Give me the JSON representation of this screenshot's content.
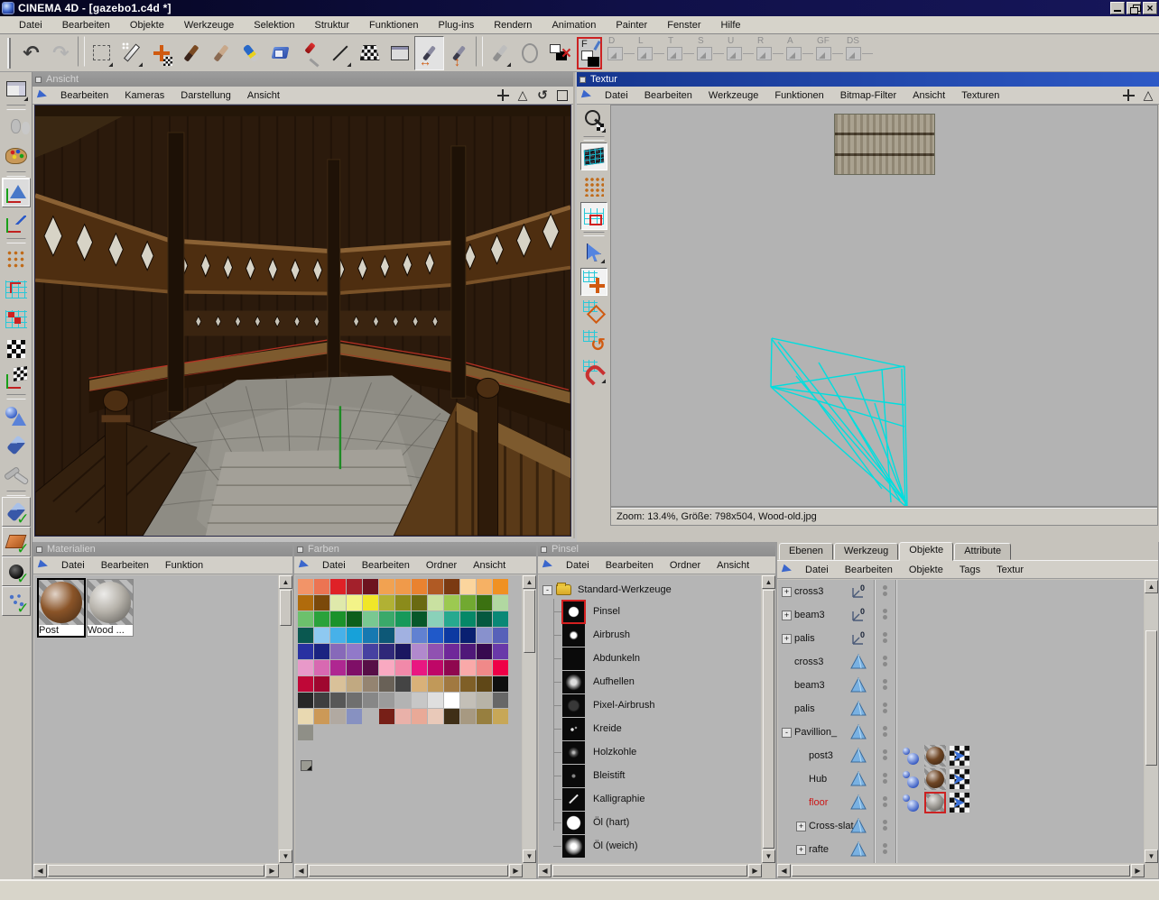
{
  "window": {
    "title": "CINEMA 4D - [gazebo1.c4d *]",
    "control_icons": [
      "minimize-icon",
      "restore-icon",
      "close-icon"
    ]
  },
  "menubar": [
    {
      "label": "Datei"
    },
    {
      "label": "Bearbeiten"
    },
    {
      "label": "Objekte"
    },
    {
      "label": "Werkzeuge"
    },
    {
      "label": "Selektion"
    },
    {
      "label": "Struktur"
    },
    {
      "label": "Funktionen"
    },
    {
      "label": "Plug-ins"
    },
    {
      "label": "Rendern"
    },
    {
      "label": "Animation"
    },
    {
      "label": "Painter"
    },
    {
      "label": "Fenster"
    },
    {
      "label": "Hilfe"
    }
  ],
  "toolbar": {
    "icons": [
      {
        "name": "undo-icon",
        "cls": "i-undo"
      },
      {
        "name": "redo-icon",
        "cls": "i-redo"
      },
      {
        "name": "separator",
        "cls": "i-sep"
      },
      {
        "name": "marquee-select-icon",
        "cls": "i-marquee"
      },
      {
        "name": "magic-wand-icon",
        "cls": "i-wand"
      },
      {
        "name": "move-texture-icon",
        "cls": "i-movetex"
      },
      {
        "name": "paint-brush-icon",
        "cls": "i-brush"
      },
      {
        "name": "smudge-tool-icon",
        "cls": "i-smudge"
      },
      {
        "name": "crayon-icon",
        "cls": "i-crayon"
      },
      {
        "name": "fill-bucket-icon",
        "cls": "i-bucket"
      },
      {
        "name": "screwdriver-tool-icon",
        "cls": "i-screw"
      },
      {
        "name": "line-tool-icon",
        "cls": "i-line"
      },
      {
        "name": "uv-mapping-icon",
        "cls": "i-uvtrap"
      },
      {
        "name": "render-settings-icon",
        "cls": "i-dialog"
      },
      {
        "name": "apply-brush-horizontal-icon",
        "cls": "i-arrh",
        "state": "pressed"
      },
      {
        "name": "apply-brush-vertical-icon",
        "cls": "i-arrv"
      },
      {
        "name": "separator",
        "cls": "i-sep"
      },
      {
        "name": "brush-preset-icon",
        "cls": "i-graybrush"
      },
      {
        "name": "oval-tool-icon",
        "cls": "i-oval"
      },
      {
        "name": "clear-layer-icon",
        "cls": "i-multix"
      }
    ],
    "active_channel": "F",
    "channels": [
      {
        "label": "D",
        "name": "channel-d-button"
      },
      {
        "label": "L",
        "name": "channel-l-button"
      },
      {
        "label": "T",
        "name": "channel-t-button"
      },
      {
        "label": "S",
        "name": "channel-s-button"
      },
      {
        "label": "U",
        "name": "channel-u-button"
      },
      {
        "label": "R",
        "name": "channel-r-button"
      },
      {
        "label": "A",
        "name": "channel-a-button"
      },
      {
        "label": "GF",
        "name": "channel-gf-button"
      },
      {
        "label": "DS",
        "name": "channel-ds-button"
      }
    ]
  },
  "left_toolbar": {
    "icons": [
      {
        "name": "layout-icon",
        "cls": "l-layout"
      },
      {
        "name": "separator",
        "cls": "lsep"
      },
      {
        "name": "history-icon",
        "cls": "l-history"
      },
      {
        "name": "palette-icon",
        "cls": "l-palette"
      },
      {
        "name": "separator",
        "cls": "lsep"
      },
      {
        "name": "view-mode-icon",
        "cls": "l-view",
        "state": "pressed"
      },
      {
        "name": "axes-icon",
        "cls": "l-axes"
      },
      {
        "name": "separator",
        "cls": "lsep"
      },
      {
        "name": "points-mode-icon",
        "cls": "l-points"
      },
      {
        "name": "uv-edge-mode-icon",
        "cls": "l-uvedge"
      },
      {
        "name": "uv-polygon-mode-icon",
        "cls": "l-uvpoly"
      },
      {
        "name": "texture-mode-icon",
        "cls": "l-checker"
      },
      {
        "name": "texture-axes-mode-icon",
        "cls": "l-checkaxes"
      },
      {
        "name": "separator",
        "cls": "lsep"
      },
      {
        "name": "object-mode-icon",
        "cls": "l-objects"
      },
      {
        "name": "eraser-icon",
        "cls": "l-eraser"
      },
      {
        "name": "kinematics-icon",
        "cls": "l-ik"
      },
      {
        "name": "separator",
        "cls": "lsep"
      },
      {
        "name": "eraser-enable-icon",
        "cls": "l-chk-eraser"
      },
      {
        "name": "polygon-enable-icon",
        "cls": "l-chk-poly"
      },
      {
        "name": "sphere-enable-icon",
        "cls": "l-chk-sphere"
      },
      {
        "name": "particles-enable-icon",
        "cls": "l-chk-part"
      }
    ]
  },
  "viewport": {
    "title": "Ansicht",
    "menus": [
      {
        "label": "Bearbeiten"
      },
      {
        "label": "Kameras"
      },
      {
        "label": "Darstellung"
      },
      {
        "label": "Ansicht"
      }
    ],
    "corner_icons": [
      {
        "name": "pan-view-icon",
        "cls": "c-pan"
      },
      {
        "name": "warn-triangle-icon",
        "cls": "c-tri"
      },
      {
        "name": "rotate-view-icon",
        "cls": "c-rot"
      },
      {
        "name": "maximize-view-icon",
        "cls": "c-max"
      }
    ]
  },
  "texture_window": {
    "title": "Textur",
    "menus": [
      {
        "label": "Datei"
      },
      {
        "label": "Bearbeiten"
      },
      {
        "label": "Werkzeuge"
      },
      {
        "label": "Funktionen"
      },
      {
        "label": "Bitmap-Filter"
      },
      {
        "label": "Ansicht"
      },
      {
        "label": "Texturen"
      }
    ],
    "corner_icons": [
      {
        "name": "pan-view-icon",
        "cls": "c-pan"
      },
      {
        "name": "warn-triangle-icon",
        "cls": "c-tri"
      }
    ],
    "tools": [
      {
        "name": "zoom-tool-icon",
        "cls": "t-zoom"
      },
      {
        "name": "separator",
        "cls": "tsep"
      },
      {
        "name": "uv-mesh-toggle-icon",
        "cls": "t-mesh",
        "state": "pressed"
      },
      {
        "name": "uv-point-mode-icon",
        "cls": "t-points"
      },
      {
        "name": "uv-polygon-mode-icon",
        "cls": "t-polys",
        "state": "pressed"
      },
      {
        "name": "separator",
        "cls": "tsep"
      },
      {
        "name": "select-tool-icon",
        "cls": "t-arrow"
      },
      {
        "name": "uv-move-tool-icon",
        "cls": "t-move",
        "state": "pressed"
      },
      {
        "name": "uv-scale-tool-icon",
        "cls": "t-scale"
      },
      {
        "name": "uv-rotate-tool-icon",
        "cls": "t-rotate"
      },
      {
        "name": "uv-magnet-tool-icon",
        "cls": "t-magnet"
      }
    ],
    "status": "Zoom: 13.4%, Größe: 798x504, Wood-old.jpg"
  },
  "materials_panel": {
    "title": "Materialien",
    "menus": [
      {
        "label": "Datei"
      },
      {
        "label": "Bearbeiten"
      },
      {
        "label": "Funktion"
      }
    ],
    "materials": [
      {
        "label": "Post",
        "color": "#8a5428",
        "sel": "sel"
      },
      {
        "label": "Wood ...",
        "color": "#b6b2aa",
        "sel": ""
      }
    ]
  },
  "colors_panel": {
    "title": "Farben",
    "menus": [
      {
        "label": "Datei"
      },
      {
        "label": "Bearbeiten"
      },
      {
        "label": "Ordner"
      },
      {
        "label": "Ansicht"
      }
    ],
    "palette": [
      "#f29468",
      "#ec7452",
      "#df2127",
      "#a3202b",
      "#6d131f",
      "#f1a251",
      "#f09a4a",
      "#e98230",
      "#b05a24",
      "#7b3a12",
      "#fbd59d",
      "#f6b164",
      "#f09122",
      "#b06b0c",
      "#7b490a",
      "#dfe9ab",
      "#f3f388",
      "#f0e628",
      "#b1b134",
      "#8b8b1b",
      "#6a6a11",
      "#c9e1a1",
      "#9cc951",
      "#71a931",
      "#3b7111",
      "#b1d8a1",
      "#6cc16c",
      "#2aa23b",
      "#1b922b",
      "#0d5f1b",
      "#79c891",
      "#3aa96a",
      "#17995a",
      "#07582a",
      "#8ad1b9",
      "#27a98f",
      "#068867",
      "#05583f",
      "#0a8876",
      "#0a5850",
      "#8ec9f1",
      "#47b1e9",
      "#17a1d9",
      "#1779b1",
      "#0d5877",
      "#a1b1e1",
      "#6181d1",
      "#2059c9",
      "#0d39a1",
      "#092071",
      "#8891cd",
      "#5761b9",
      "#2831a1",
      "#1b2481",
      "#8769b9",
      "#9179c9",
      "#4741a1",
      "#2f2879",
      "#1b1761",
      "#b189cd",
      "#9051b1",
      "#6f2899",
      "#4f1879",
      "#37094f",
      "#6939a9",
      "#e899c9",
      "#d869b1",
      "#af2791",
      "#7f0f67",
      "#570f47",
      "#f9a9c1",
      "#f189a9",
      "#e91781",
      "#bf0767",
      "#8f074f",
      "#f9a9a9",
      "#f08989",
      "#ef0047",
      "#bf0737",
      "#9f072f",
      "#d9c199",
      "#c1a981",
      "#948471",
      "#696157",
      "#444444",
      "#d9b179",
      "#c19959",
      "#a17941",
      "#7f5f27",
      "#5f4717",
      "#0f0f0f",
      "#272727",
      "#3f3f3f",
      "#575757",
      "#6f6f6f",
      "#878787",
      "#9b9b9b",
      "#b3b3b3",
      "#c7c7c7",
      "#dfdfdf",
      "#ffffff",
      "#c3bfb7",
      "#b7b3a7",
      "#676767",
      "#e9d9b1",
      "#cc9957",
      "#b1a9a1",
      "#8791c1",
      "",
      "#771f17",
      "#e9b1a9",
      "#e9a997",
      "#e9c9b9",
      "#3f2f17",
      "#a79981",
      "#977f3f",
      "#c7a757",
      "#8f8f87",
      "",
      "",
      "",
      "",
      "",
      "",
      "",
      "",
      "",
      "",
      "",
      ""
    ]
  },
  "brushes_panel": {
    "title": "Pinsel",
    "menus": [
      {
        "label": "Datei"
      },
      {
        "label": "Bearbeiten"
      },
      {
        "label": "Ordner"
      },
      {
        "label": "Ansicht"
      }
    ],
    "folder": "Standard-Werkzeuge",
    "folder_icon": "folder-icon",
    "brushes": [
      {
        "label": "Pinsel",
        "thumb": "dot-lg",
        "sel": "sel"
      },
      {
        "label": "Airbrush",
        "thumb": "dot-sm",
        "sel": ""
      },
      {
        "label": "Abdunkeln",
        "thumb": "blank",
        "sel": ""
      },
      {
        "label": "Aufhellen",
        "thumb": "dot-soft",
        "sel": ""
      },
      {
        "label": "Pixel-Airbrush",
        "thumb": "dot-faint",
        "sel": ""
      },
      {
        "label": "Kreide",
        "thumb": "speck",
        "sel": ""
      },
      {
        "label": "Holzkohle",
        "thumb": "speck2",
        "sel": ""
      },
      {
        "label": "Bleistift",
        "thumb": "dot-tiny",
        "sel": ""
      },
      {
        "label": "Kalligraphie",
        "thumb": "stroke",
        "sel": ""
      },
      {
        "label": "Öl (hart)",
        "thumb": "ring",
        "sel": ""
      },
      {
        "label": "Öl (weich)",
        "thumb": "dot-soft2",
        "sel": ""
      }
    ]
  },
  "objects_panel": {
    "tabs": [
      {
        "label": "Ebenen",
        "state": ""
      },
      {
        "label": "Werkzeug",
        "state": ""
      },
      {
        "label": "Objekte",
        "state": "active"
      },
      {
        "label": "Attribute",
        "state": ""
      }
    ],
    "menus": [
      {
        "label": "Datei"
      },
      {
        "label": "Bearbeiten"
      },
      {
        "label": "Objekte"
      },
      {
        "label": "Tags"
      },
      {
        "label": "Textur"
      }
    ],
    "rows": [
      {
        "label": "cross3",
        "exp": "+",
        "icon": "null",
        "child": "",
        "sel": "",
        "tag": "",
        "mat": "",
        "matsel": ""
      },
      {
        "label": "beam3",
        "exp": "+",
        "icon": "null",
        "child": "",
        "sel": "",
        "tag": "",
        "mat": "",
        "matsel": ""
      },
      {
        "label": "palis",
        "exp": "+",
        "icon": "null",
        "child": "",
        "sel": "",
        "tag": "",
        "mat": "",
        "matsel": ""
      },
      {
        "label": "cross3",
        "exp": "",
        "icon": "pyr",
        "child": "",
        "sel": "",
        "tag": "",
        "mat": "",
        "matsel": ""
      },
      {
        "label": "beam3",
        "exp": "",
        "icon": "pyr",
        "child": "",
        "sel": "",
        "tag": "",
        "mat": "",
        "matsel": ""
      },
      {
        "label": "palis",
        "exp": "",
        "icon": "pyr",
        "child": "",
        "sel": "",
        "tag": "",
        "mat": "",
        "matsel": ""
      },
      {
        "label": "Pavillion_",
        "exp": "-",
        "icon": "pyr",
        "child": "",
        "sel": "",
        "tag": "",
        "mat": "",
        "matsel": ""
      },
      {
        "label": "post3",
        "exp": "",
        "icon": "pyr",
        "child": "child",
        "sel": "",
        "tag": "show",
        "mat": "#6e4524",
        "matsel": ""
      },
      {
        "label": "Hub",
        "exp": "",
        "icon": "pyr",
        "child": "child",
        "sel": "",
        "tag": "show",
        "mat": "#6e4524",
        "matsel": ""
      },
      {
        "label": "floor",
        "exp": "",
        "icon": "pyr",
        "child": "child",
        "sel": "sel",
        "tag": "show",
        "mat": "#a3a09a",
        "matsel": "matsel"
      },
      {
        "label": "Cross-slat",
        "exp": "+",
        "icon": "pyr",
        "child": "child",
        "sel": "",
        "tag": "",
        "mat": "",
        "matsel": ""
      },
      {
        "label": "rafte",
        "exp": "+",
        "icon": "pyr",
        "child": "child",
        "sel": "",
        "tag": "",
        "mat": "",
        "matsel": ""
      }
    ]
  }
}
